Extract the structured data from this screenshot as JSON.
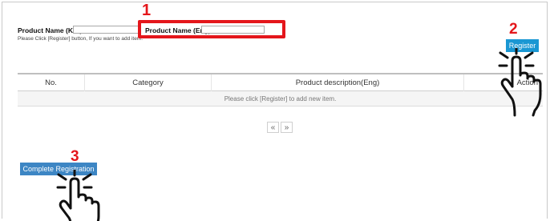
{
  "form": {
    "kor_label": "Product Name (Kor):",
    "kor_value": "",
    "eng_label": "Product Name (Eng):",
    "eng_value": "",
    "note": "Please Click [Register] button, If you want to add item."
  },
  "callouts": {
    "step1": "1",
    "step2": "2",
    "step3": "3"
  },
  "register_label": "Register",
  "table": {
    "headers": [
      "No.",
      "Category",
      "Product description(Eng)",
      "Action"
    ],
    "empty_message": "Please click [Register] to add new item."
  },
  "pagination": {
    "prev": "«",
    "next": "»"
  },
  "complete_label": "Complete Registration",
  "colors": {
    "accent": "#1a97d3",
    "complete_button": "#3d86c4",
    "callout": "#e4161b"
  },
  "icons": [
    "hand-pointer-icon"
  ]
}
